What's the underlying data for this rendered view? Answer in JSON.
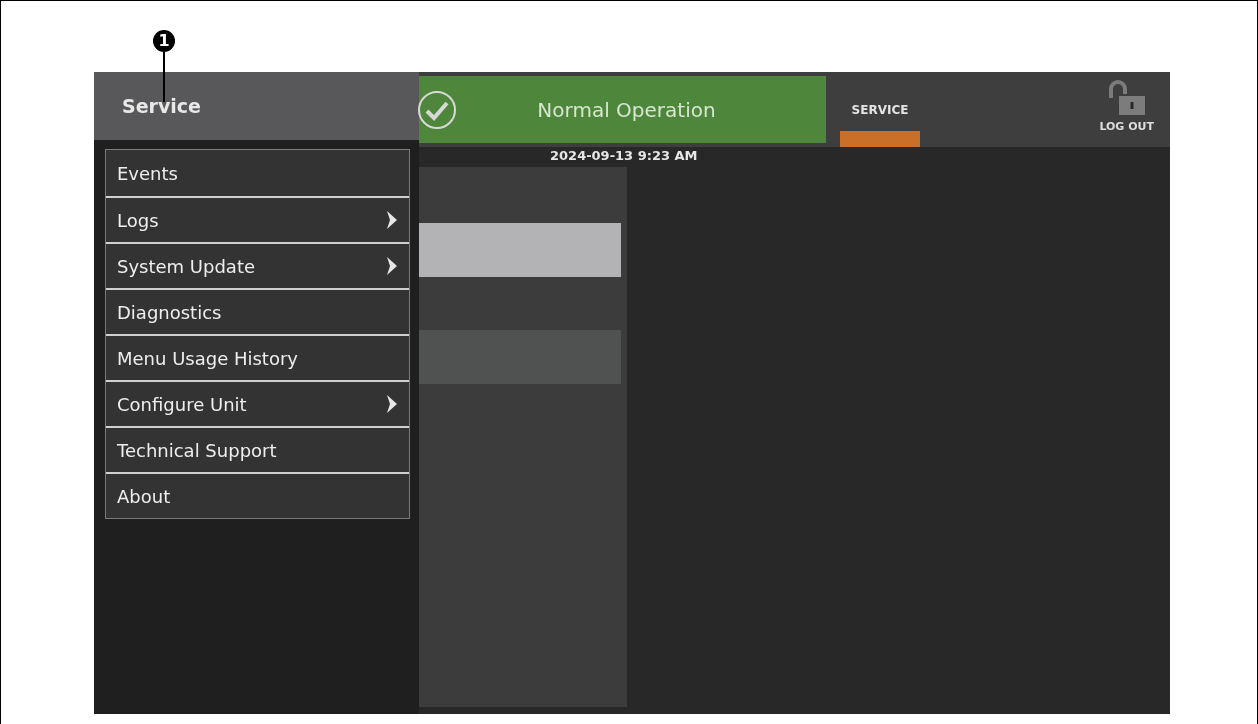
{
  "callout": {
    "number": "1"
  },
  "side_menu": {
    "title": "Service",
    "items": [
      {
        "label": "Events",
        "has_submenu": false
      },
      {
        "label": "Logs",
        "has_submenu": true
      },
      {
        "label": "System Update",
        "has_submenu": true
      },
      {
        "label": "Diagnostics",
        "has_submenu": false
      },
      {
        "label": "Menu Usage History",
        "has_submenu": false
      },
      {
        "label": "Configure Unit",
        "has_submenu": true
      },
      {
        "label": "Technical Support",
        "has_submenu": false
      },
      {
        "label": "About",
        "has_submenu": false
      }
    ]
  },
  "status_banner": {
    "kind": "ok",
    "status": "Normal Operation"
  },
  "tabs": [
    {
      "label": "SERVICE",
      "selected": true
    }
  ],
  "logout_button": {
    "label": "LOG OUT"
  },
  "datetime": "2024-09-13 9:23 AM",
  "panel_rows": [
    {
      "selected": true
    },
    {
      "selected": false
    }
  ]
}
